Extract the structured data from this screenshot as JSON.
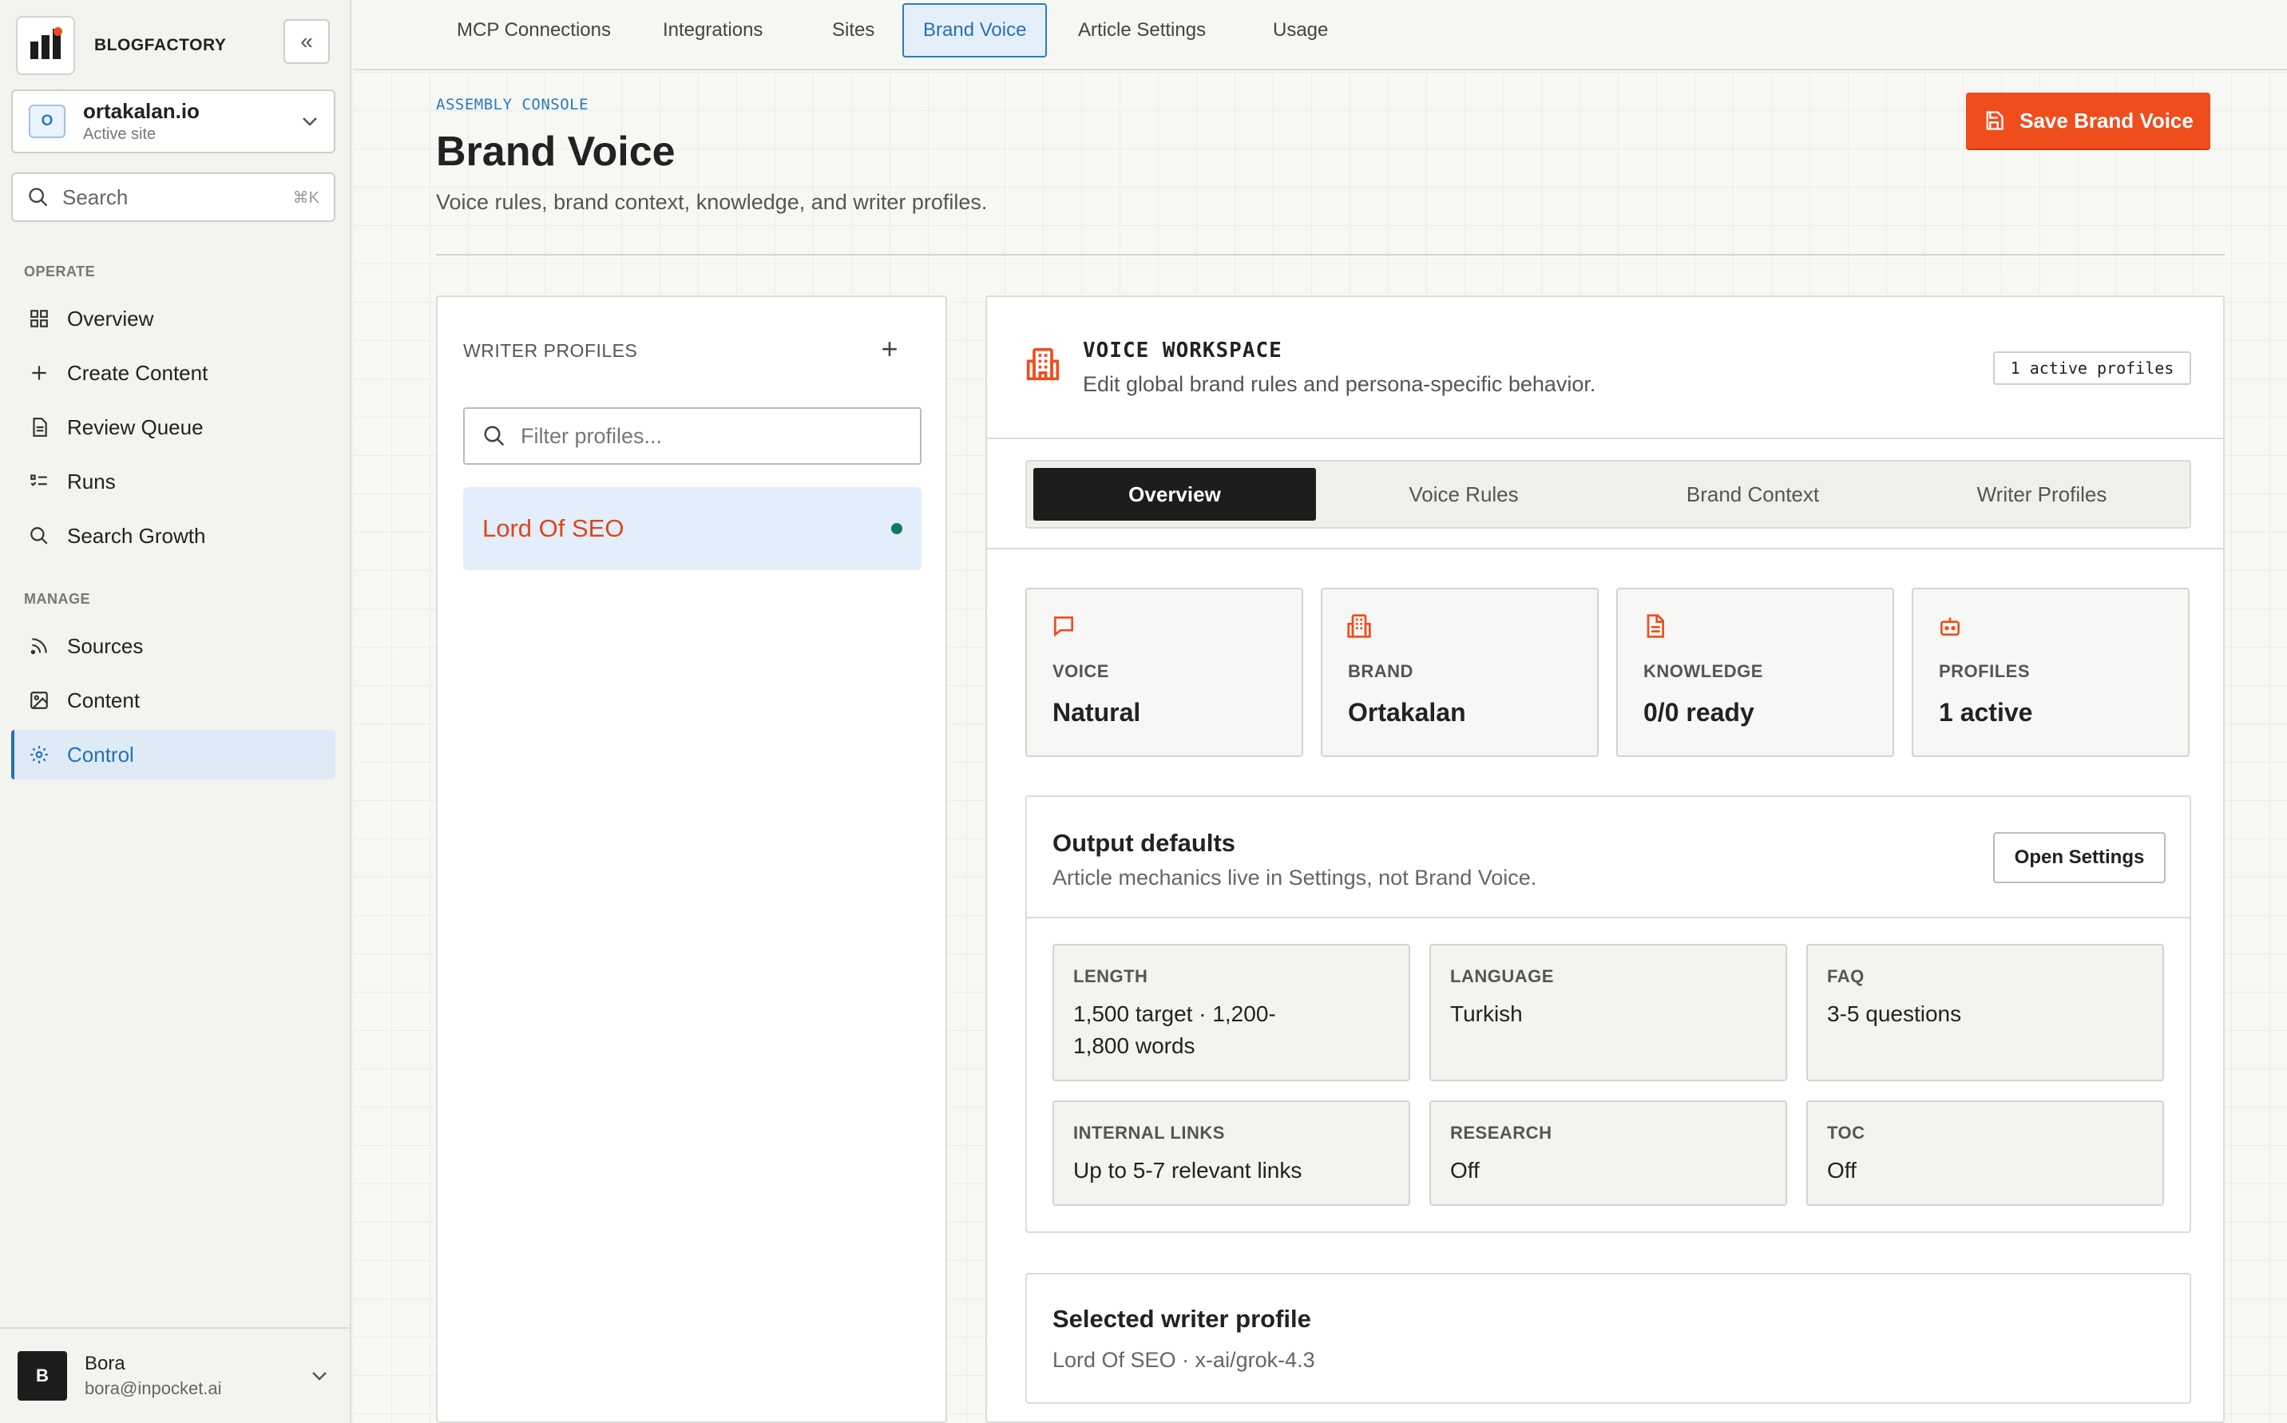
{
  "app": {
    "brand": "BLOGFACTORY",
    "site_name": "ortakalan.io",
    "site_sub": "Active site",
    "site_avatar": "O",
    "search_placeholder": "Search",
    "search_shortcut": "⌘K"
  },
  "sidebar": {
    "operate_label": "OPERATE",
    "manage_label": "MANAGE",
    "operate_items": [
      {
        "label": "Overview",
        "icon": "grid-icon"
      },
      {
        "label": "Create Content",
        "icon": "plus-icon"
      },
      {
        "label": "Review Queue",
        "icon": "document-icon"
      },
      {
        "label": "Runs",
        "icon": "list-checks-icon"
      },
      {
        "label": "Search Growth",
        "icon": "search-icon"
      }
    ],
    "manage_items": [
      {
        "label": "Sources",
        "icon": "rss-icon"
      },
      {
        "label": "Content",
        "icon": "image-icon"
      },
      {
        "label": "Control",
        "icon": "gear-icon",
        "active": true
      }
    ]
  },
  "user": {
    "initial": "B",
    "name": "Bora",
    "email": "bora@inpocket.ai"
  },
  "top_tabs": [
    "MCP Connections",
    "Integrations",
    "Sites",
    "Brand Voice",
    "Article Settings",
    "Usage"
  ],
  "active_top_tab": "Brand Voice",
  "header": {
    "eyebrow": "ASSEMBLY CONSOLE",
    "title": "Brand Voice",
    "subtitle": "Voice rules, brand context, knowledge, and writer profiles.",
    "save_label": "Save Brand Voice"
  },
  "writer_profiles": {
    "title": "WRITER PROFILES",
    "filter_placeholder": "Filter profiles...",
    "items": [
      {
        "name": "Lord Of SEO",
        "active": true
      }
    ]
  },
  "workspace": {
    "title": "VOICE WORKSPACE",
    "subtitle": "Edit global brand rules and persona-specific behavior.",
    "badge": "1 active profiles",
    "tabs": [
      "Overview",
      "Voice Rules",
      "Brand Context",
      "Writer Profiles"
    ],
    "active_tab": "Overview",
    "stats": [
      {
        "label": "VOICE",
        "value": "Natural",
        "icon": "message-icon"
      },
      {
        "label": "BRAND",
        "value": "Ortakalan",
        "icon": "building-icon"
      },
      {
        "label": "KNOWLEDGE",
        "value": "0/0 ready",
        "icon": "file-text-icon"
      },
      {
        "label": "PROFILES",
        "value": "1 active",
        "icon": "bot-icon"
      }
    ],
    "output_defaults": {
      "title": "Output defaults",
      "subtitle": "Article mechanics live in Settings, not Brand Voice.",
      "button": "Open Settings",
      "cells": [
        {
          "label": "LENGTH",
          "value": "1,500 target · 1,200-1,800 words"
        },
        {
          "label": "LANGUAGE",
          "value": "Turkish"
        },
        {
          "label": "FAQ",
          "value": "3-5 questions"
        },
        {
          "label": "INTERNAL LINKS",
          "value": "Up to 5-7 relevant links"
        },
        {
          "label": "RESEARCH",
          "value": "Off"
        },
        {
          "label": "TOC",
          "value": "Off"
        }
      ]
    },
    "selected_profile": {
      "title": "Selected writer profile",
      "value": "Lord Of SEO · x-ai/grok-4.3"
    }
  },
  "colors": {
    "accent": "#f04d1d",
    "link": "#2670b5",
    "status_green": "#0f7c5a"
  }
}
